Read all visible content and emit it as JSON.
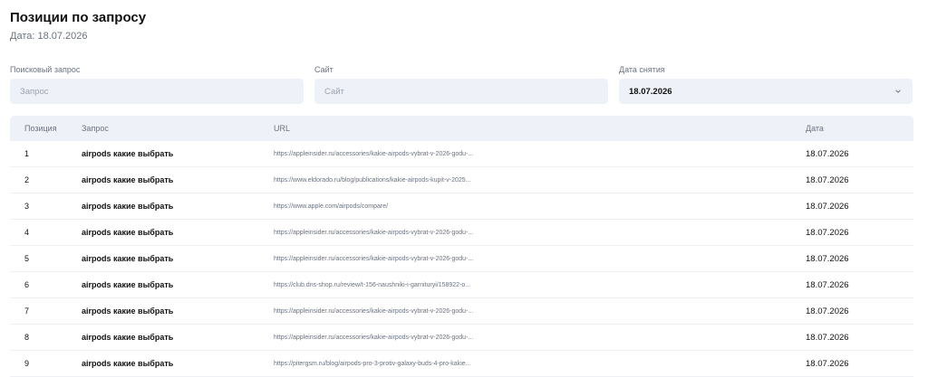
{
  "page": {
    "title": "Позиции по запросу",
    "subtitle": "Дата: 18.07.2026"
  },
  "filters": {
    "query_label": "Поисковый запрос",
    "query_placeholder": "Запрос",
    "site_label": "Сайт",
    "site_placeholder": "Сайт",
    "date_label": "Дата снятия",
    "date_value": "18.07.2026"
  },
  "table": {
    "headers": [
      "Позиция",
      "Запрос",
      "URL",
      "Дата"
    ],
    "rows": [
      {
        "pos": "1",
        "query": "airpods какие выбрать",
        "url": "https://appleinsider.ru/accessories/kakie-airpods-vybrat-v-2026-godu-...",
        "date": "18.07.2026"
      },
      {
        "pos": "2",
        "query": "airpods какие выбрать",
        "url": "https://www.eldorado.ru/blog/publications/kakie-airpods-kupit-v-2025...",
        "date": "18.07.2026"
      },
      {
        "pos": "3",
        "query": "airpods какие выбрать",
        "url": "https://www.apple.com/airpods/compare/",
        "date": "18.07.2026"
      },
      {
        "pos": "4",
        "query": "airpods какие выбрать",
        "url": "https://appleinsider.ru/accessories/kakie-airpods-vybrat-v-2026-godu-...",
        "date": "18.07.2026"
      },
      {
        "pos": "5",
        "query": "airpods какие выбрать",
        "url": "https://appleinsider.ru/accessories/kakie-airpods-vybrat-v-2026-godu-...",
        "date": "18.07.2026"
      },
      {
        "pos": "6",
        "query": "airpods какие выбрать",
        "url": "https://club.dns-shop.ru/review/t-156-naushniki-i-garnituryi/158922-o...",
        "date": "18.07.2026"
      },
      {
        "pos": "7",
        "query": "airpods какие выбрать",
        "url": "https://appleinsider.ru/accessories/kakie-airpods-vybrat-v-2026-godu-...",
        "date": "18.07.2026"
      },
      {
        "pos": "8",
        "query": "airpods какие выбрать",
        "url": "https://appleinsider.ru/accessories/kakie-airpods-vybrat-v-2026-godu-...",
        "date": "18.07.2026"
      },
      {
        "pos": "9",
        "query": "airpods какие выбрать",
        "url": "https://pitergsm.ru/blog/airpods-pro-3-protiv-galaxy-buds-4-pro-kakie...",
        "date": "18.07.2026"
      }
    ]
  },
  "icons": {
    "date_dropdown": "chevron-down-icon"
  },
  "colors": {
    "field_bg": "#eef2f8",
    "header_bg": "#eef2f8",
    "muted_text": "#6b7280"
  }
}
